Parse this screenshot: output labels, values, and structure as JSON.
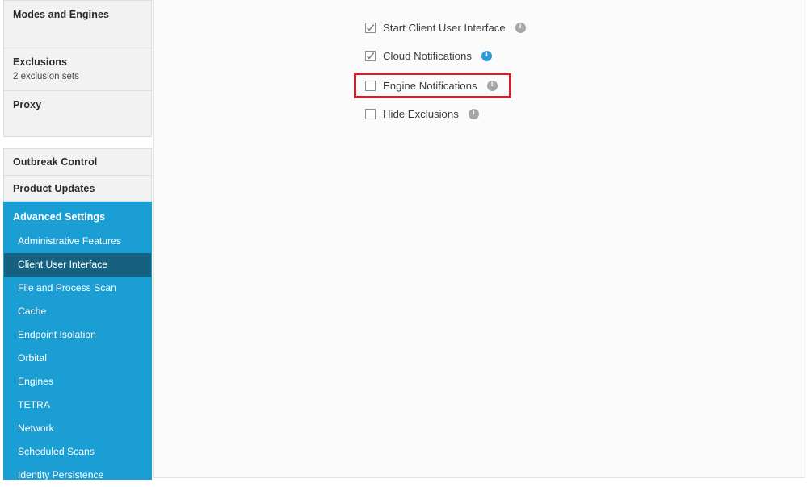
{
  "sidebar": {
    "groups": [
      {
        "name": "settings-group",
        "cards": [
          {
            "title": "Modes and Engines",
            "sub": ""
          },
          {
            "title": "Exclusions",
            "sub": "2 exclusion sets"
          },
          {
            "title": "Proxy",
            "sub": ""
          }
        ]
      },
      {
        "name": "control-group",
        "cards": [
          {
            "title": "Outbreak Control",
            "sub": ""
          },
          {
            "title": "Product Updates",
            "sub": ""
          }
        ]
      }
    ],
    "advanced": {
      "header": "Advanced Settings",
      "accent_color": "#1a9ed4",
      "selected_color": "#15617f",
      "selected": "Client User Interface",
      "items": [
        "Administrative Features",
        "Client User Interface",
        "File and Process Scan",
        "Cache",
        "Endpoint Isolation",
        "Orbital",
        "Engines",
        "TETRA",
        "Network",
        "Scheduled Scans",
        "Identity Persistence"
      ]
    }
  },
  "main": {
    "highlight_color": "#c9252d",
    "options": [
      {
        "label": "Start Client User Interface",
        "checked": true,
        "info_color": "gray",
        "highlighted": false
      },
      {
        "label": "Cloud Notifications",
        "checked": true,
        "info_color": "blue",
        "highlighted": false
      },
      {
        "label": "Engine Notifications",
        "checked": false,
        "info_color": "gray",
        "highlighted": true
      },
      {
        "label": "Hide Exclusions",
        "checked": false,
        "info_color": "gray",
        "highlighted": false
      }
    ],
    "info_icon_name": "info-icon",
    "info_glyph": "i"
  }
}
